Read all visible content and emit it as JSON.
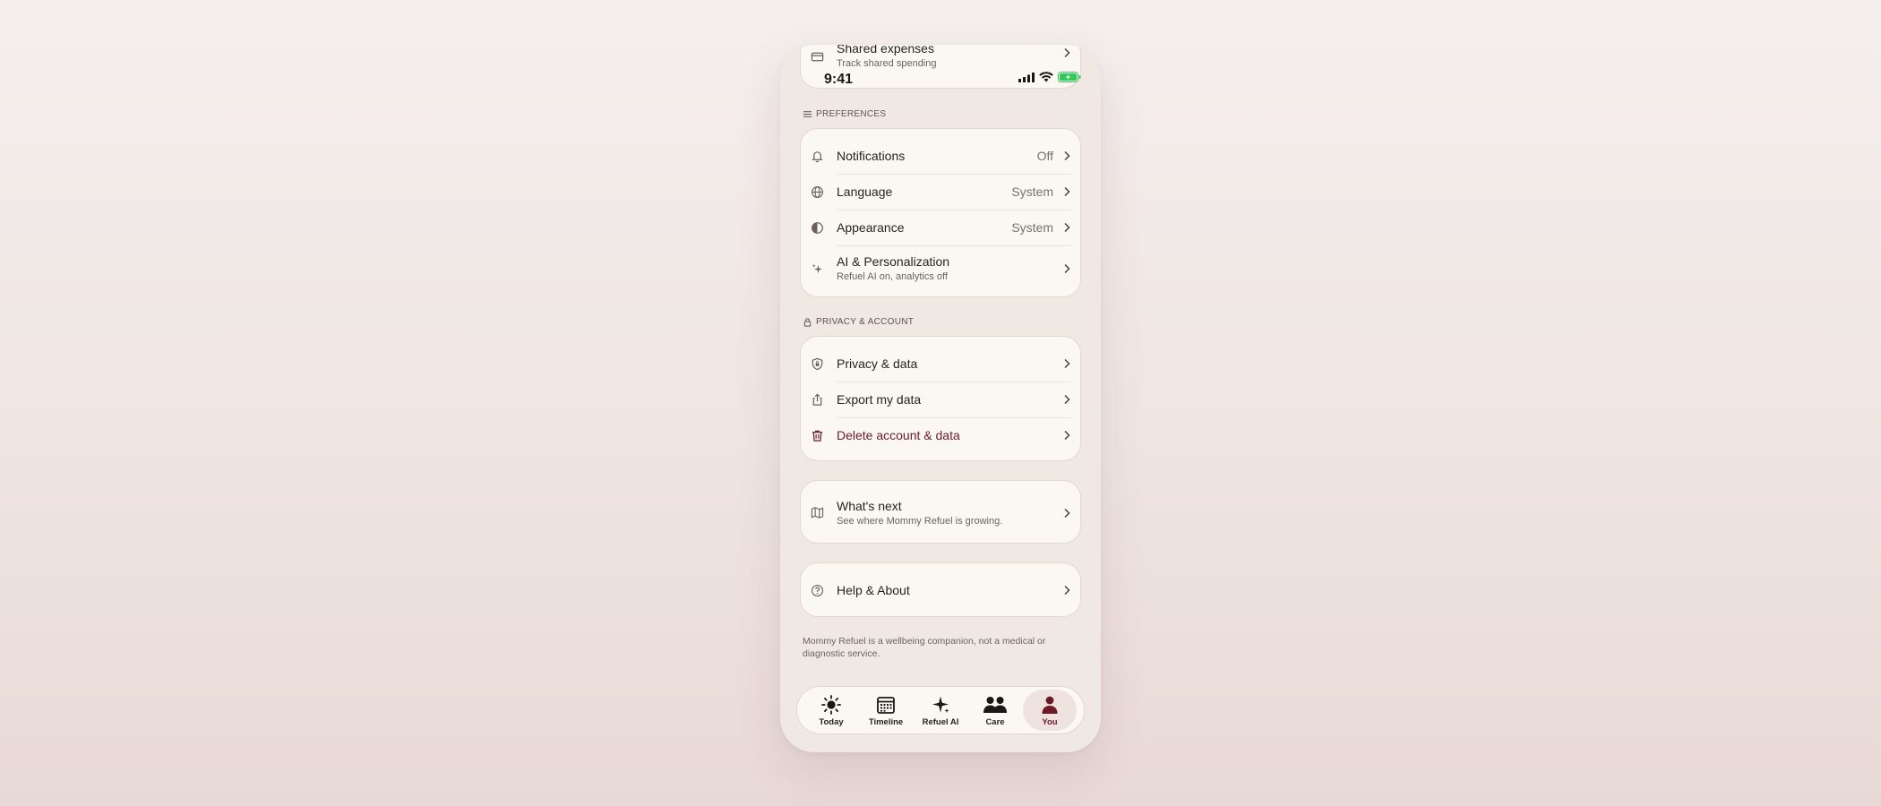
{
  "status_bar": {
    "time": "9:41"
  },
  "top_card": {
    "label": "Shared expenses",
    "sub": "Track shared spending"
  },
  "preferences": {
    "title": "PREFERENCES",
    "items": [
      {
        "label": "Notifications",
        "value": "Off",
        "icon": "bell-icon"
      },
      {
        "label": "Language",
        "value": "System",
        "icon": "globe-icon"
      },
      {
        "label": "Appearance",
        "value": "System",
        "icon": "contrast-icon"
      },
      {
        "label": "AI & Personalization",
        "sub": "Refuel AI on, analytics off",
        "icon": "sparkle-icon"
      }
    ]
  },
  "privacy": {
    "title": "PRIVACY & ACCOUNT",
    "items": [
      {
        "label": "Privacy & data",
        "icon": "shield-icon"
      },
      {
        "label": "Export my data",
        "icon": "share-icon"
      },
      {
        "label": "Delete account & data",
        "icon": "trash-icon",
        "color": "#6d1a26"
      }
    ]
  },
  "whats_next": {
    "label": "What's next",
    "sub": "See where Mommy Refuel is growing."
  },
  "help": {
    "label": "Help & About"
  },
  "disclaimer": "Mommy Refuel is a wellbeing companion, not a medical or diagnostic service.",
  "tabs": [
    {
      "label": "Today",
      "icon": "sun-icon"
    },
    {
      "label": "Timeline",
      "icon": "calendar-icon"
    },
    {
      "label": "Refuel AI",
      "icon": "sparkle-icon"
    },
    {
      "label": "Care",
      "icon": "people-icon"
    },
    {
      "label": "You",
      "icon": "person-icon",
      "active": true
    }
  ],
  "colors": {
    "accent": "#6d1a26",
    "card": "#fbf8f4",
    "battery": "#34c759"
  }
}
